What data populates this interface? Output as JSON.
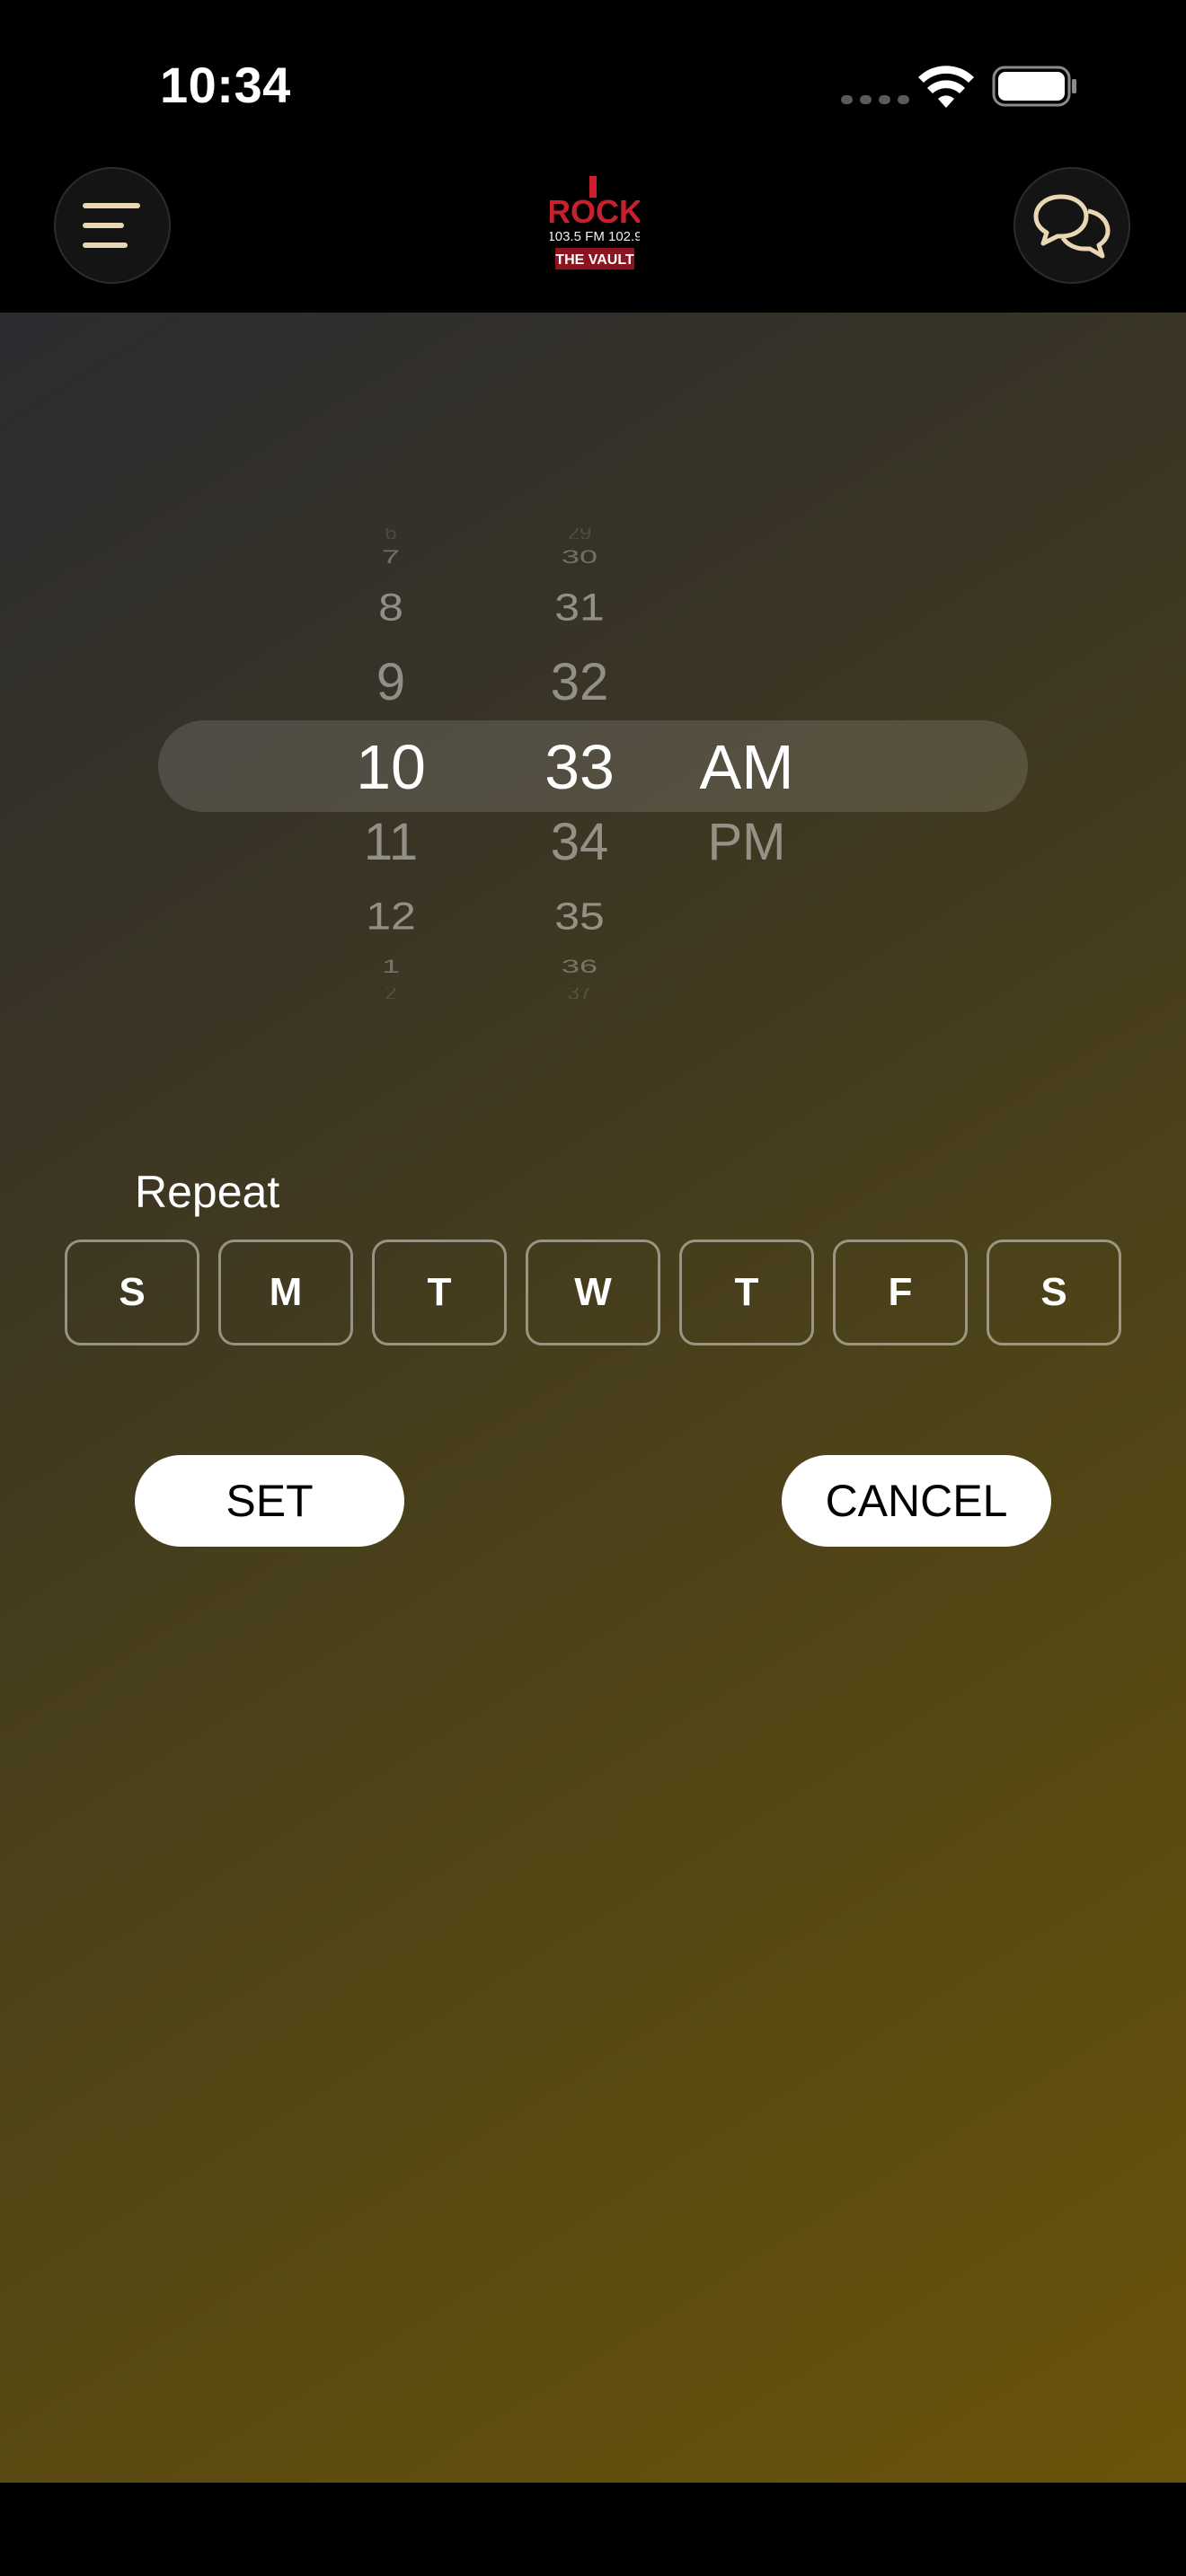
{
  "status_bar": {
    "time": "10:34"
  },
  "header": {
    "menu_icon": "menu-icon",
    "chat_icon": "chat-bubbles-icon",
    "logo": {
      "line1": "ROCK",
      "line2": "103.5 FM 102.9",
      "line3": "THE VAULT"
    }
  },
  "colors": {
    "accent": "#e9d7b4",
    "logo_red": "#c8202c",
    "highlight": "#ffffff"
  },
  "time_picker": {
    "hours": [
      "6",
      "7",
      "8",
      "9",
      "10",
      "11",
      "12",
      "1",
      "2"
    ],
    "minutes": [
      "29",
      "30",
      "31",
      "32",
      "33",
      "34",
      "35",
      "36",
      "37"
    ],
    "periods": [
      "AM",
      "PM"
    ],
    "selected_hour": "10",
    "selected_minute": "33",
    "selected_period": "AM"
  },
  "repeat": {
    "label": "Repeat",
    "days": [
      "S",
      "M",
      "T",
      "W",
      "T",
      "F",
      "S"
    ]
  },
  "actions": {
    "set_label": "SET",
    "cancel_label": "CANCEL"
  }
}
